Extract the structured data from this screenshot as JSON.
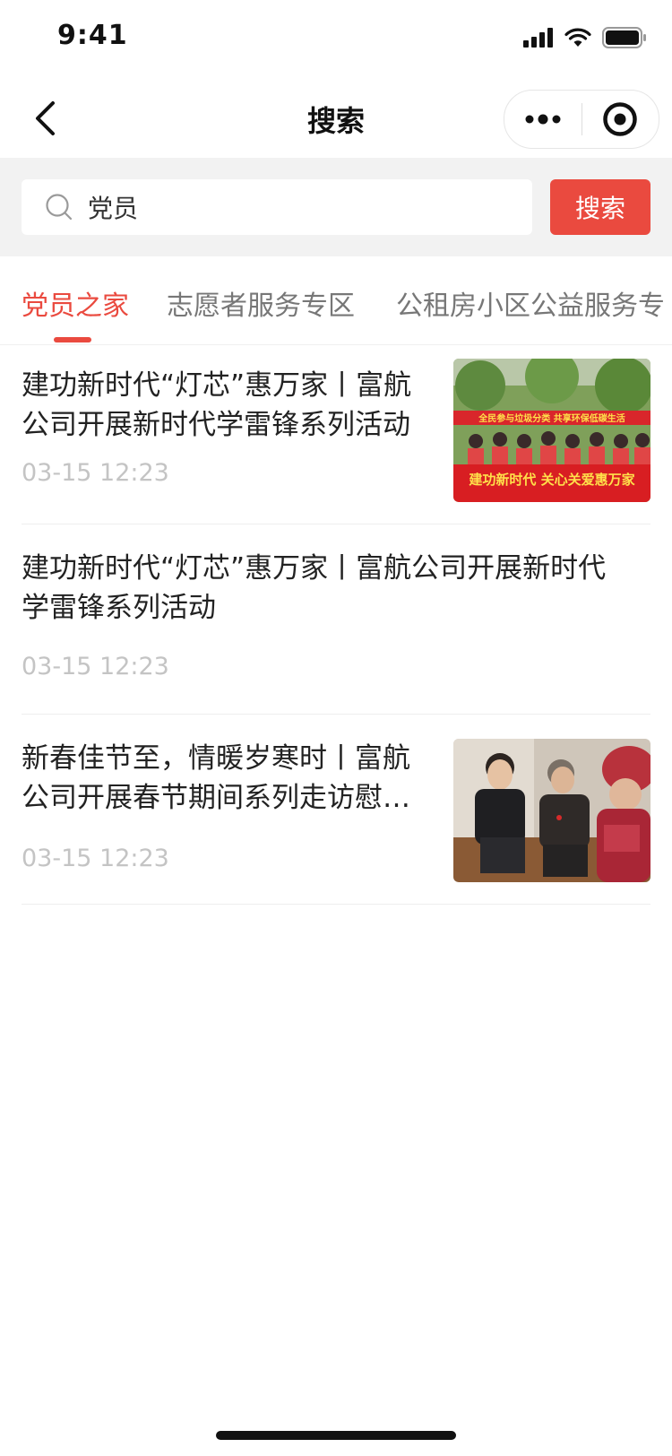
{
  "status_bar": {
    "time": "9:41"
  },
  "nav": {
    "title": "搜索"
  },
  "search": {
    "value": "党员",
    "button_label": "搜索"
  },
  "tabs": [
    {
      "label": "党员之家",
      "active": true
    },
    {
      "label": "志愿者服务专区",
      "active": false
    },
    {
      "label": "公租房小区公益服务专",
      "active": false
    }
  ],
  "articles": [
    {
      "title": "建功新时代“灯芯”惠万家丨富航公司开展新时代学雷锋系列活动",
      "date": "03-15 12:23",
      "has_image": true,
      "image_text_top": "全民参与垃圾分类 共享环保低碳生活",
      "image_text_main": "建功新时代 关心关爱惠万家"
    },
    {
      "title": "建功新时代“灯芯”惠万家丨富航公司开展新时代学雷锋系列活动",
      "date": "03-15 12:23",
      "has_image": false
    },
    {
      "title": "新春佳节至，情暖岁寒时丨富航公司开展春节期间系列走访慰问活动",
      "date": "03-15 12:23",
      "has_image": true
    }
  ],
  "colors": {
    "accent": "#ea4a3f",
    "muted": "#c4c4c4",
    "tab_inactive": "#777777"
  }
}
